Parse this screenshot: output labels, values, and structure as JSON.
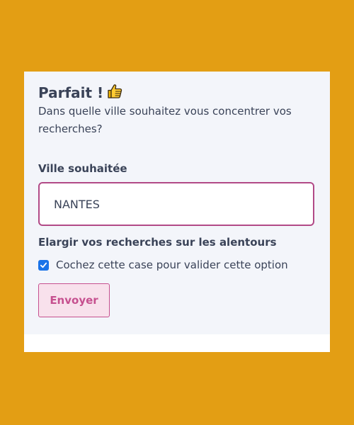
{
  "form": {
    "title": "Parfait !",
    "title_emoji_icon": "thumbs-up-icon",
    "intro": "Dans quelle ville souhaitez vous concentrer vos recherches?",
    "city_label": "Ville souhaitée",
    "city_value": "NANTES",
    "widen_label": "Elargir vos recherches sur les alentours",
    "checkbox_label": "Cochez cette case pour valider cette option",
    "checkbox_checked": true,
    "submit_label": "Envoyer"
  },
  "colors": {
    "page_background": "#E39E14",
    "card_background": "#F3F5FA",
    "text": "#3A4358",
    "input_border": "#B24A87",
    "button_text": "#C6508F",
    "button_background": "#F8E1EC",
    "checkbox": "#1A73E8"
  }
}
